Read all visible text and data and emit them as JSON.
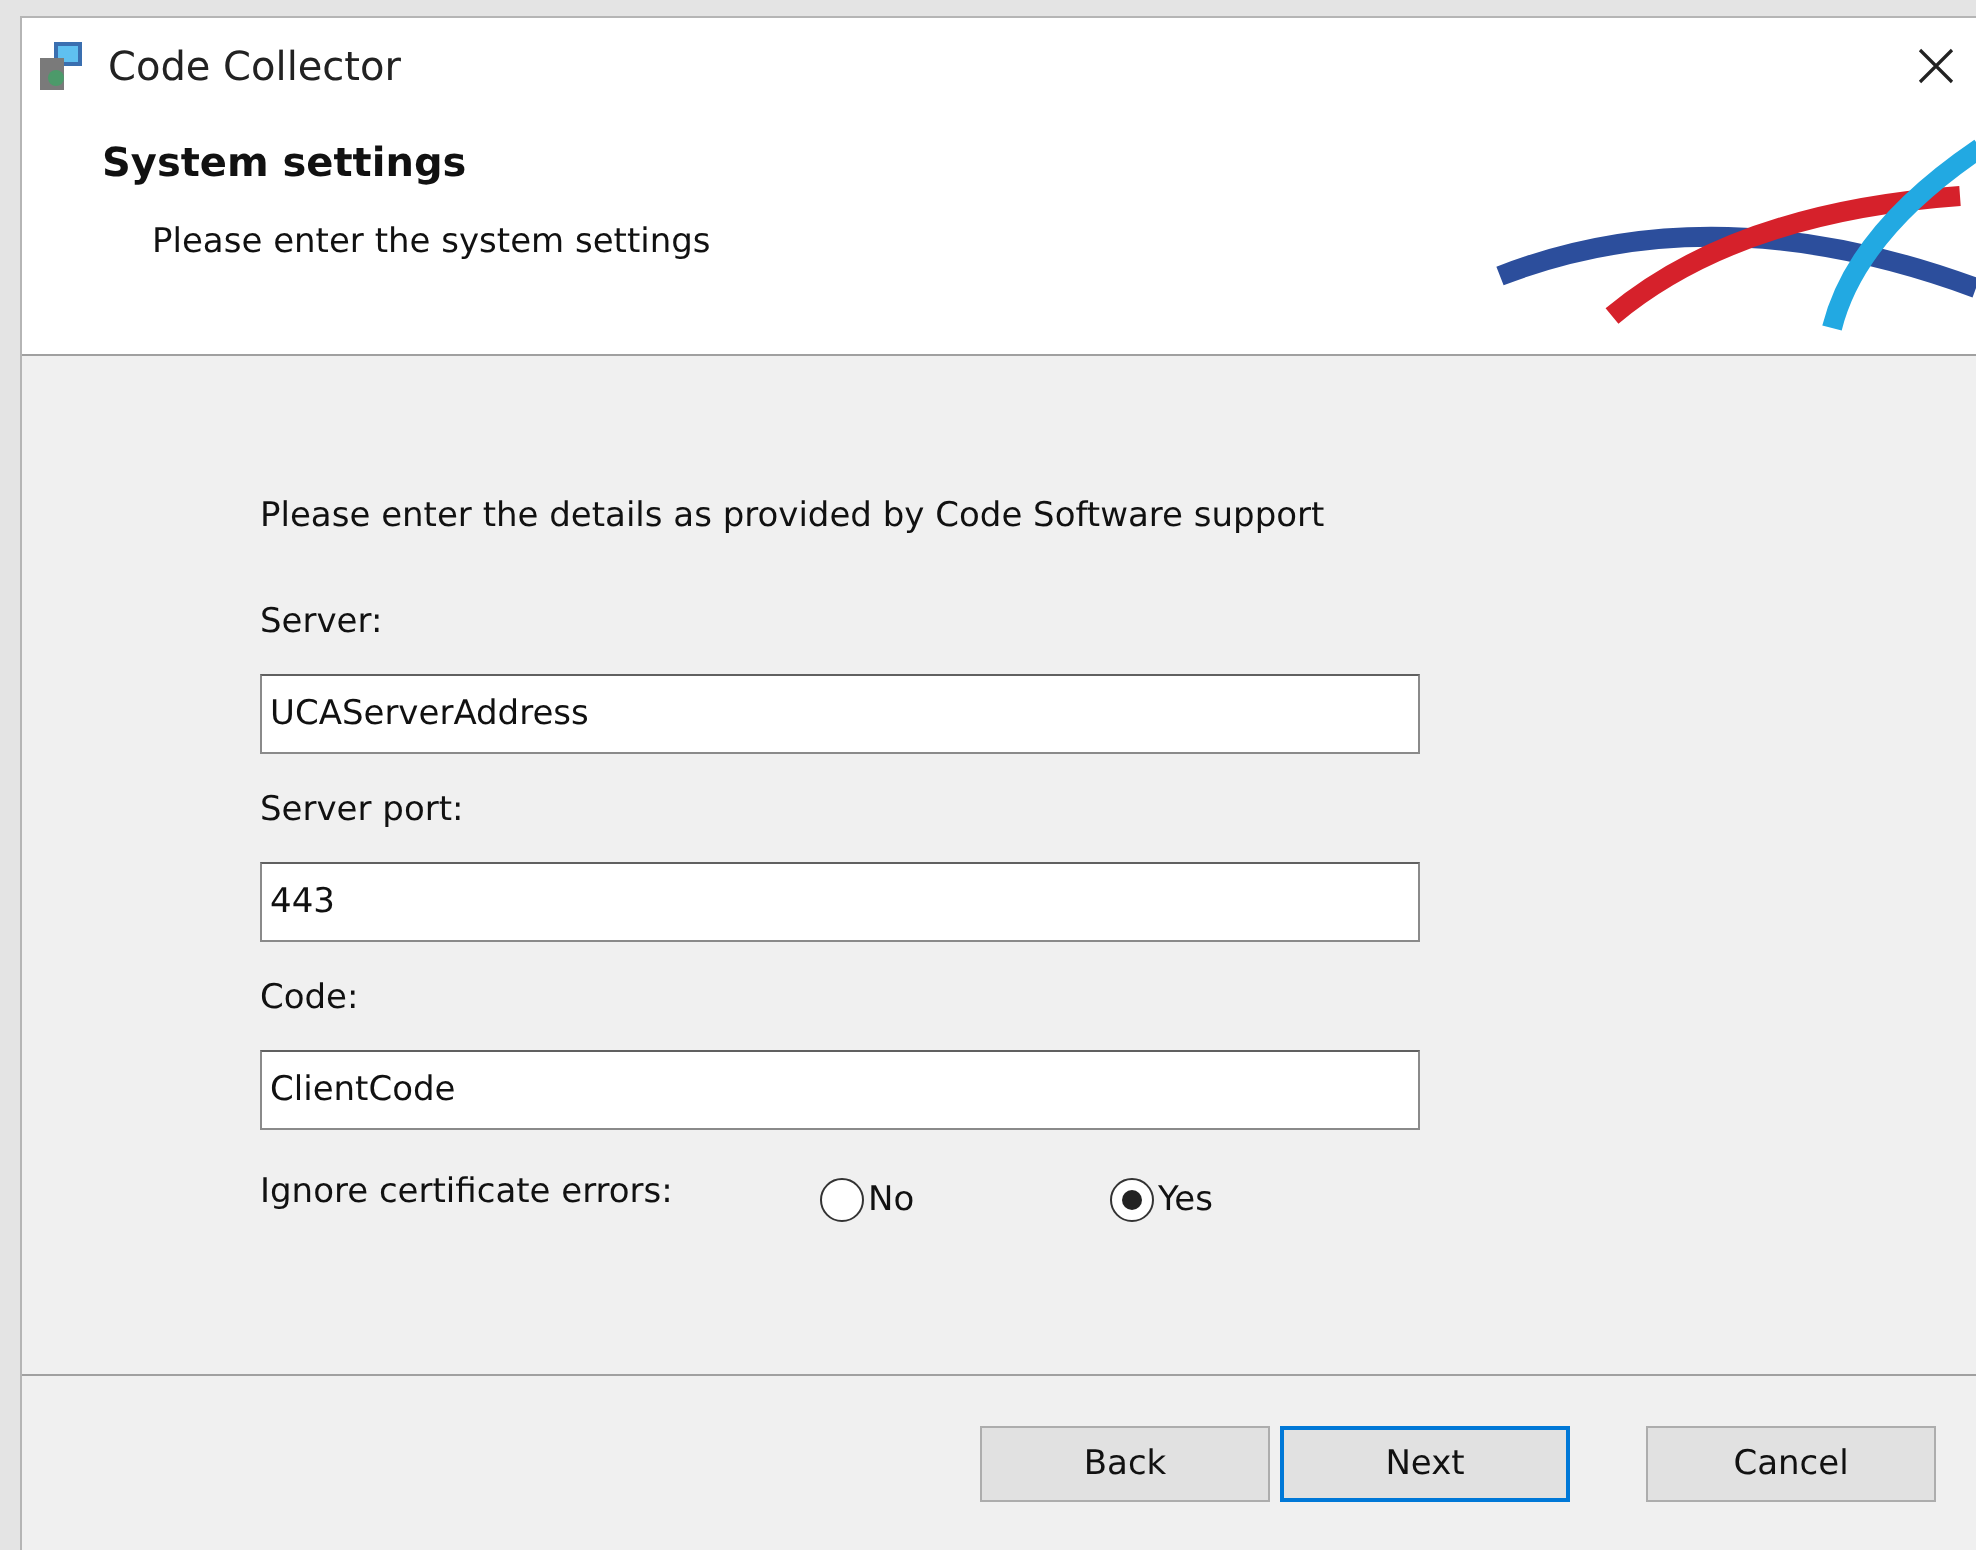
{
  "window": {
    "title": "Code Collector"
  },
  "header": {
    "title": "System settings",
    "subtitle": "Please enter the system settings"
  },
  "intro": "Please enter the details as provided by Code Software support",
  "fields": [
    {
      "label": "Server:",
      "value": "UCAServerAddress"
    },
    {
      "label": "Server port:",
      "value": "443"
    },
    {
      "label": "Code:",
      "value": "ClientCode"
    }
  ],
  "ignore_certificate_errors": {
    "label": "Ignore certificate errors:",
    "options": [
      {
        "label": "No",
        "selected": false
      },
      {
        "label": "Yes",
        "selected": true
      }
    ]
  },
  "buttons": [
    {
      "label": "Back",
      "default": false
    },
    {
      "label": "Next",
      "default": true
    },
    {
      "label": "Cancel",
      "default": false
    }
  ]
}
